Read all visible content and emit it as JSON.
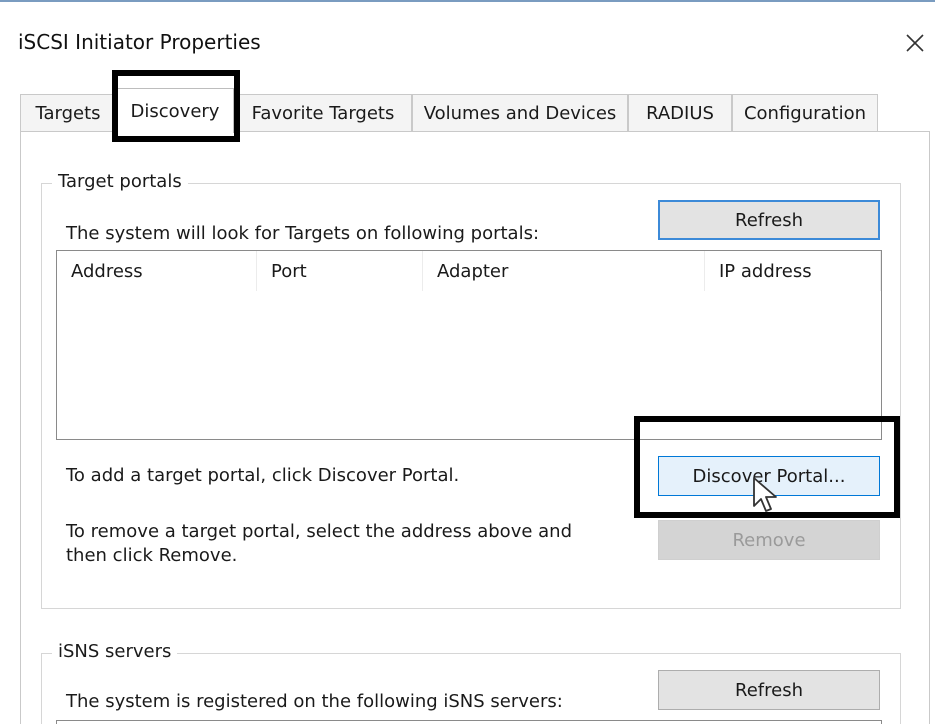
{
  "window": {
    "title": "iSCSI Initiator Properties",
    "close_glyph": "✕"
  },
  "tabs": [
    {
      "label": "Targets"
    },
    {
      "label": "Discovery"
    },
    {
      "label": "Favorite Targets"
    },
    {
      "label": "Volumes and Devices"
    },
    {
      "label": "RADIUS"
    },
    {
      "label": "Configuration"
    }
  ],
  "active_tab": "Discovery",
  "target_portals": {
    "legend": "Target portals",
    "description": "The system will look for Targets on following portals:",
    "refresh_label": "Refresh",
    "columns": [
      "Address",
      "Port",
      "Adapter",
      "IP address"
    ],
    "rows": [],
    "add_hint": "To add a target portal, click Discover Portal.",
    "discover_label": "Discover Portal...",
    "remove_hint_line1": "To remove a target portal, select the address above and",
    "remove_hint_line2": "then click Remove.",
    "remove_label": "Remove"
  },
  "isns_servers": {
    "legend": "iSNS servers",
    "description": "The system is registered on the following iSNS servers:",
    "refresh_label": "Refresh"
  },
  "icons": {
    "close": "close-icon",
    "cursor": "mouse-pointer-icon"
  },
  "colors": {
    "default_button_border": "#3c8ad8",
    "hover_button_border": "#0078d7",
    "highlight_box": "#000000",
    "window_top_border": "#7a9cc0"
  }
}
